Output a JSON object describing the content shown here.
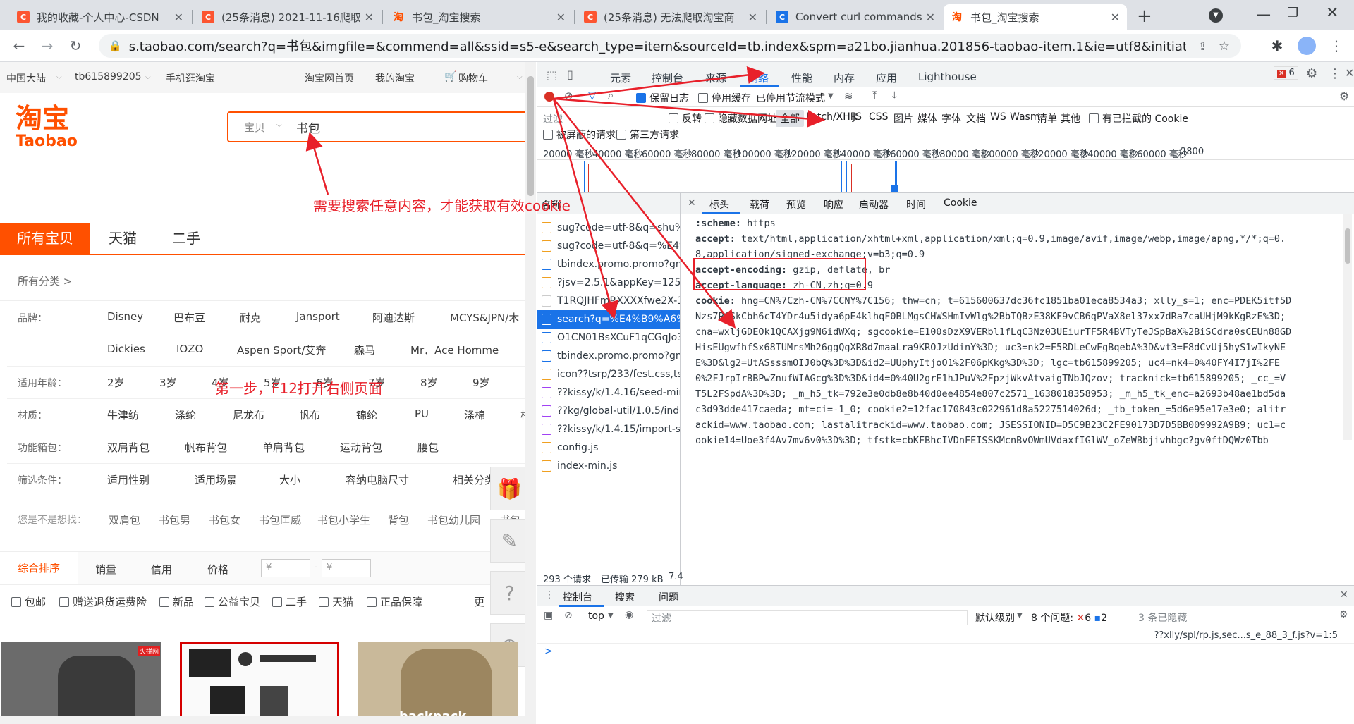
{
  "browser": {
    "tabs": [
      {
        "title": "我的收藏-个人中心-CSDN",
        "icon": "csdn-icon",
        "color": "#fc5531"
      },
      {
        "title": "(25条消息) 2021-11-16爬取",
        "icon": "csdn-icon",
        "color": "#fc5531"
      },
      {
        "title": "书包_淘宝搜索",
        "icon": "taobao-icon",
        "color": "#ff5000"
      },
      {
        "title": "(25条消息) 无法爬取淘宝商",
        "icon": "csdn-icon",
        "color": "#fc5531"
      },
      {
        "title": "Convert curl commands t",
        "icon": "convert-icon",
        "color": "#1a73e8"
      },
      {
        "title": "书包_淘宝搜索",
        "icon": "taobao-icon",
        "color": "#ff5000",
        "active": true
      }
    ],
    "url": "s.taobao.com/search?q=书包&imgfile=&commend=all&ssid=s5-e&search_type=item&sourceId=tb.index&spm=a21bo.jianhua.201856-taobao-item.1&ie=utf8&initiative_id=tbind..."
  },
  "taobao": {
    "topnav": {
      "region": "中国大陆",
      "user": "tb615899205",
      "mobile": "手机逛淘宝",
      "home": "淘宝网首页",
      "my": "我的淘宝",
      "cart": "购物车"
    },
    "logo": {
      "cn": "淘宝",
      "en": "Taobao"
    },
    "search": {
      "scope": "宝贝",
      "query": "书包"
    },
    "cattabs": [
      "所有宝贝",
      "天猫",
      "二手"
    ],
    "all_categories": "所有分类 >",
    "filters": [
      {
        "label": "品牌：",
        "items": [
          "Disney",
          "巴布豆",
          "耐克",
          "Jansport",
          "阿迪达斯",
          "MCYS&JPN/木"
        ]
      },
      {
        "label": "",
        "items": [
          "Dickies",
          "IOZO",
          "Aspen Sport/艾奔",
          "森马",
          "Mr．Ace Homme"
        ]
      },
      {
        "label": "适用年龄：",
        "items": [
          "2岁",
          "3岁",
          "4岁",
          "5岁",
          "6岁",
          "7岁",
          "8岁",
          "9岁"
        ]
      },
      {
        "label": "材质：",
        "items": [
          "牛津纺",
          "涤纶",
          "尼龙布",
          "帆布",
          "锦纶",
          "PU",
          "涤棉",
          "棉"
        ]
      },
      {
        "label": "功能箱包：",
        "items": [
          "双肩背包",
          "帆布背包",
          "单肩背包",
          "运动背包",
          "腰包"
        ]
      },
      {
        "label": "筛选条件：",
        "items": [
          "适用性别",
          "适用场景",
          "大小",
          "容纳电脑尺寸",
          "相关分类"
        ]
      }
    ],
    "suggest": {
      "label": "您是不是想找：",
      "items": [
        "双肩包",
        "书包男",
        "书包女",
        "书包匡威",
        "书包小学生",
        "背包",
        "书包幼儿园",
        "书包n"
      ]
    },
    "sort": [
      "综合排序",
      "销量",
      "信用",
      "价格"
    ],
    "price_from": "¥",
    "price_to": "¥",
    "checks": [
      "包邮",
      "赠送退货运费险",
      "新品",
      "公益宝贝",
      "二手",
      "天猫",
      "正品保障"
    ],
    "more": "更",
    "product_text": "backpack"
  },
  "devtools": {
    "tabs": [
      "元素",
      "控制台",
      "来源",
      "网络",
      "性能",
      "内存",
      "应用",
      "Lighthouse"
    ],
    "issues_count": "6",
    "net_toolbar": {
      "preserve_log": "保留日志",
      "disable_cache": "停用缓存",
      "throttle": "已停用节流模式"
    },
    "filter_placeholder": "过滤",
    "invert": "反转",
    "hide_data_urls": "隐藏数据网址",
    "types": [
      "全部",
      "Fetch/XHR",
      "JS",
      "CSS",
      "图片",
      "媒体",
      "字体",
      "文档",
      "WS",
      "Wasm",
      "清单",
      "其他"
    ],
    "blocked_cookies": "有已拦截的 Cookie",
    "blocked_requests": "被屏蔽的请求",
    "third_party": "第三方请求",
    "timeline": [
      "20000 毫秒",
      "40000 毫秒",
      "60000 毫秒",
      "80000 毫秒",
      "100000 毫秒",
      "120000 毫秒",
      "140000 毫秒",
      "160000 毫秒",
      "180000 毫秒",
      "200000 毫秒",
      "220000 毫秒",
      "240000 毫秒",
      "260000 毫秒",
      "2800"
    ],
    "name_header": "名称",
    "requests": [
      "sug?code=utf-8&q=shu%7b",
      "sug?code=utf-8&q=%E4%B9",
      "tbindex.promo.promo?gmkey",
      "?jsv=2.5.1&appKey=1257447",
      "T1RQJHFmRXXXXfwe2X-15-5",
      "search?q=%E4%B9%A6%E5%",
      "O1CN01BsXCuF1qCGqJo3Ezc",
      "tbindex.promo.promo?gmkey",
      "icon??tsrp/233/fest.css,tsrp/1",
      "??kissy/k/1.4.16/seed-min.js,k",
      "??kg/global-util/1.0.5/index-",
      "??kissy/k/1.4.15/import-style-",
      "config.js",
      "index-min.js"
    ],
    "summary": {
      "requests": "293 个请求",
      "transferred": "已传输 279 kB",
      "more": "7.4"
    },
    "detail_tabs": [
      "标头",
      "载荷",
      "预览",
      "响应",
      "启动器",
      "时间",
      "Cookie"
    ],
    "headers": [
      {
        "k": ":scheme:",
        "v": "https"
      },
      {
        "k": "accept:",
        "v": "text/html,application/xhtml+xml,application/xml;q=0.9,image/avif,image/webp,image/apng,*/*;q=0."
      },
      {
        "k": "",
        "v": "8,application/signed-exchange;v=b3;q=0.9"
      },
      {
        "k": "accept-encoding:",
        "v": "gzip, deflate, br"
      },
      {
        "k": "accept-language:",
        "v": "zh-CN,zh;q=0.9"
      },
      {
        "k": "cookie:",
        "v": "hng=CN%7Czh-CN%7CCNY%7C156; thw=cn; t=615600637dc36fc1851ba01eca8534a3; xlly_s=1; enc=PDEK5itf5D"
      },
      {
        "k": "",
        "v": "Nzs7PCSkCbh6cT4YDr4u5idya6pE4klhqF0BLMgsCHWSHmIvWlg%2BbTQBzE38KF9vCB6qPVaX8el37xx7dRa7caUHjM9kKgRzE%3D;"
      },
      {
        "k": "",
        "v": "cna=wxljGDEOk1QCAXjg9N6idWXq; sgcookie=E100sDzX9VERbl1fLqC3Nz03UEiurTF5R4BVTyTeJSpBaX%2BiSCdra0sCEUn88GD"
      },
      {
        "k": "",
        "v": "HisEUgwfhfSx68TUMrsMh26ggQgXR8d7maaLra9KROJzUdinY%3D; uc3=nk2=F5RDLeCwFgBqebA%3D&vt3=F8dCvUj5hyS1wIkyNE"
      },
      {
        "k": "",
        "v": "E%3D&lg2=UtASsssmOIJ0bQ%3D%3D&id2=UUphyItjoO1%2F06pKkg%3D%3D; lgc=tb615899205; uc4=nk4=0%40FY4I7jI%2FE"
      },
      {
        "k": "",
        "v": "0%2FJrpIrBBPwZnufWIAGcg%3D%3D&id4=0%40U2grE1hJPuV%2FpzjWkvAtvaigTNbJQzov; tracknick=tb615899205; _cc_=V"
      },
      {
        "k": "",
        "v": "T5L2FSpdA%3D%3D; _m_h5_tk=792e3e0db8e8b40d0ee4854e807c2571_1638018358953; _m_h5_tk_enc=a2693b48ae1bd5da"
      },
      {
        "k": "",
        "v": "c3d93dde417caeda; mt=ci=-1_0; cookie2=12fac170843c022961d8a5227514026d; _tb_token_=5d6e95e17e3e0; alitr"
      },
      {
        "k": "",
        "v": "ackid=www.taobao.com; lastalitrackid=www.taobao.com; JSESSIONID=D5C9B23C2FE90173D7D5BB009992A9B9; uc1=c"
      },
      {
        "k": "",
        "v": "ookie14=Uoe3f4Av7mv6v0%3D%3D; tfstk=cbKFBhcIVDnFEISSKMcnBvOWmUVdaxfIGlWV_oZeWBbjivhbgc?gv0ftDQWz0Tbb"
      }
    ],
    "drawer_tabs": [
      "控制台",
      "搜索",
      "问题"
    ],
    "drawer": {
      "context": "top",
      "filter": "过滤",
      "level": "默认级别",
      "issues": "8 个问题:",
      "err": "6",
      "info": "2",
      "hidden": "3 条已隐藏"
    },
    "console_link": "??xlly/spl/rp.js,sec...s_e_88_3_f.js?v=1:5",
    "prompt": ">"
  },
  "annotations": {
    "a1": "需要搜索任意内容，才能获取有效cookie",
    "a2": "第一步，F12打开右侧页面"
  }
}
